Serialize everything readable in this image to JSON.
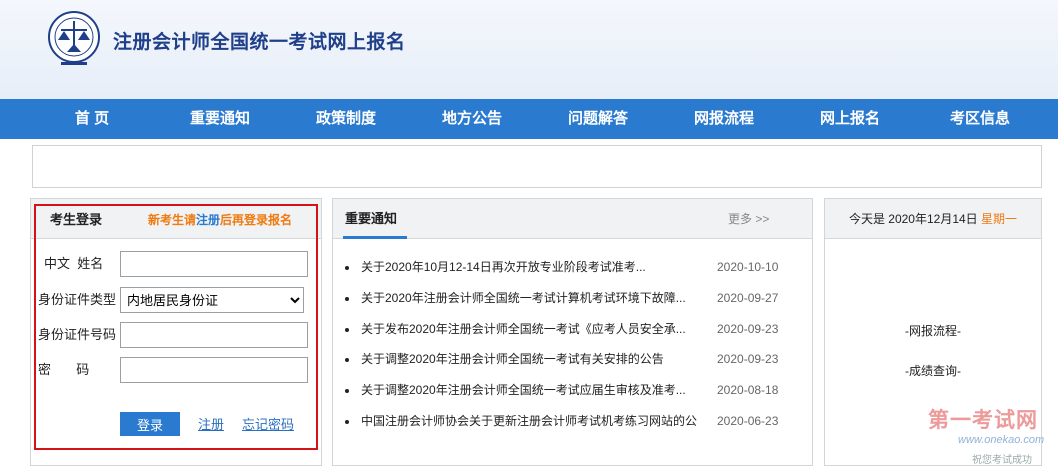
{
  "header": {
    "site_title": "注册会计师全国统一考试网上报名",
    "logo_icon": "cicpa-seal-logo",
    "background": "#eaf0f8"
  },
  "nav": {
    "items": [
      {
        "label": "首 页"
      },
      {
        "label": "重要通知"
      },
      {
        "label": "政策制度"
      },
      {
        "label": "地方公告"
      },
      {
        "label": "问题解答"
      },
      {
        "label": "网报流程"
      },
      {
        "label": "网上报名"
      },
      {
        "label": "考区信息"
      }
    ],
    "color": "#2a7ad0"
  },
  "login": {
    "title": "考生登录",
    "hint_before": "新考生请",
    "hint_link": "注册",
    "hint_after": "后再登录报名",
    "fields": {
      "name_label": "中文  姓名",
      "name_value": "",
      "id_type_label": "身份证件类型",
      "id_type_selected": "内地居民身份证",
      "id_number_label": "身份证件号码",
      "id_number_value": "",
      "password_label": "密       码",
      "password_value": ""
    },
    "login_button": "登录",
    "register_link": "注册",
    "forgot_link": "忘记密码",
    "highlight_color": "#d3121b"
  },
  "news": {
    "title": "重要通知",
    "more": "更多 >>",
    "items": [
      {
        "text": "关于2020年10月12-14日再次开放专业阶段考试准考...",
        "date": "2020-10-10"
      },
      {
        "text": "关于2020年注册会计师全国统一考试计算机考试环境下故障...",
        "date": "2020-09-27"
      },
      {
        "text": "关于发布2020年注册会计师全国统一考试《应考人员安全承...",
        "date": "2020-09-23"
      },
      {
        "text": "关于调整2020年注册会计师全国统一考试有关安排的公告",
        "date": "2020-09-23"
      },
      {
        "text": "关于调整2020年注册会计师全国统一考试应届生审核及准考...",
        "date": "2020-08-18"
      },
      {
        "text": "中国注册会计师协会关于更新注册会计师考试机考练习网站的公...",
        "date": "2020-06-23"
      }
    ]
  },
  "side": {
    "today_prefix": "今天是 2020年12月14日",
    "weekday": "星期一",
    "links": [
      "-网报流程-",
      "-成绩查询-"
    ]
  },
  "watermark": {
    "main": "第一考试网",
    "sub": "www.onekao.com",
    "tag": "祝您考试成功"
  }
}
